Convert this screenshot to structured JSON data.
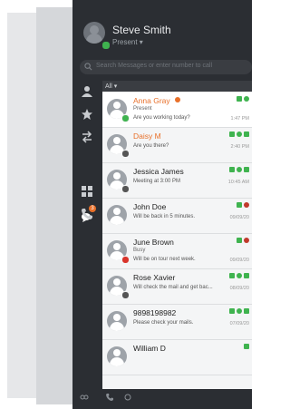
{
  "user": {
    "name": "Steve Smith",
    "status": "Present ▾"
  },
  "search": {
    "placeholder": "Search Messages or enter number to call"
  },
  "filter": {
    "label": "All ▾"
  },
  "rail": {
    "chat_badge": "3"
  },
  "contacts": [
    {
      "name": "Anna Gray",
      "status": "Present",
      "message": "Are you working today?",
      "time": "1:47 PM",
      "presence_color": "#3fb34f",
      "actions": [
        "#3fb34f",
        "#3fb34f"
      ],
      "badge_color": "#e8702a"
    },
    {
      "name": "Daisy M",
      "message": "Are you there?",
      "time": "2:40 PM",
      "presence_color": "#555555",
      "actions": [
        "#3fb34f",
        "#3fb34f",
        "#3fb34f"
      ]
    },
    {
      "name": "Jessica James",
      "message": "Meeting at 3:00 PM",
      "time": "10:45 AM",
      "presence_color": "#555555",
      "actions": [
        "#3fb34f",
        "#3fb34f",
        "#3fb34f"
      ]
    },
    {
      "name": "John Doe",
      "message": "Will be back in 5 minutes.",
      "time": "09/09/20",
      "presence_color": "",
      "actions": [
        "#3fb34f",
        "#c0392b"
      ]
    },
    {
      "name": "June Brown",
      "status": "Busy",
      "message": "Will be on tour next week.",
      "time": "09/09/20",
      "presence_color": "#d9342b",
      "actions": [
        "#3fb34f",
        "#c0392b"
      ]
    },
    {
      "name": "Rose Xavier",
      "message": "Will check the mail and get bac...",
      "time": "08/09/20",
      "presence_color": "#555555",
      "actions": [
        "#3fb34f",
        "#3fb34f",
        "#3fb34f"
      ]
    },
    {
      "name": "9898198982",
      "message": "Please check your mails.",
      "time": "07/09/20",
      "presence_color": "",
      "actions": [
        "#3fb34f",
        "#3fb34f",
        "#3fb34f"
      ]
    },
    {
      "name": "William D",
      "message": "",
      "time": "",
      "presence_color": "",
      "actions": [
        "#3fb34f"
      ]
    }
  ]
}
